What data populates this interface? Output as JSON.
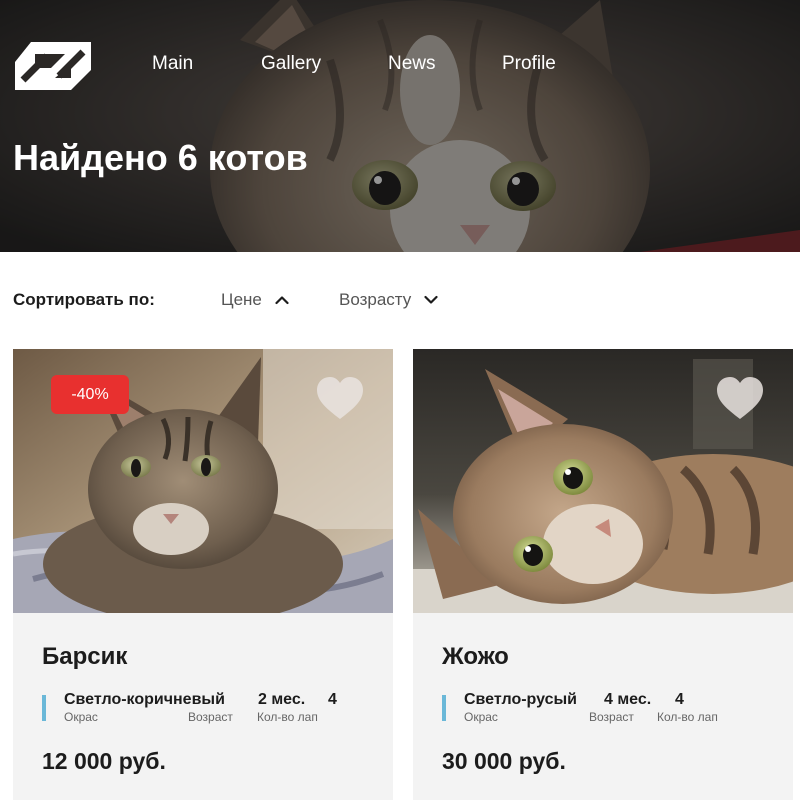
{
  "nav": {
    "items": [
      {
        "label": "Main"
      },
      {
        "label": "Gallery"
      },
      {
        "label": "News"
      },
      {
        "label": "Profile"
      }
    ]
  },
  "hero": {
    "title": "Найдено 6 котов"
  },
  "sort": {
    "label": "Сортировать по:",
    "options": [
      {
        "label": "Цене",
        "direction": "up"
      },
      {
        "label": "Возрасту",
        "direction": "down"
      }
    ]
  },
  "cards": [
    {
      "discount": "-40%",
      "name": "Барсик",
      "color_value": "Светло-коричневый",
      "color_label": "Окрас",
      "age_value": "2 мес.",
      "age_label": "Возраст",
      "paws_value": "4",
      "paws_label": "Кол-во лап",
      "price": "12 000 руб.",
      "favorite_icon": "heart-icon"
    },
    {
      "name": "Жожо",
      "color_value": "Светло-русый",
      "color_label": "Окрас",
      "age_value": "4 мес.",
      "age_label": "Возраст",
      "paws_value": "4",
      "paws_label": "Кол-во лап",
      "price": "30 000 руб.",
      "favorite_icon": "heart-icon"
    }
  ],
  "colors": {
    "badge": "#e8302f",
    "accent_bar": "#6ab8d8",
    "card_bg": "#f3f3f3"
  }
}
